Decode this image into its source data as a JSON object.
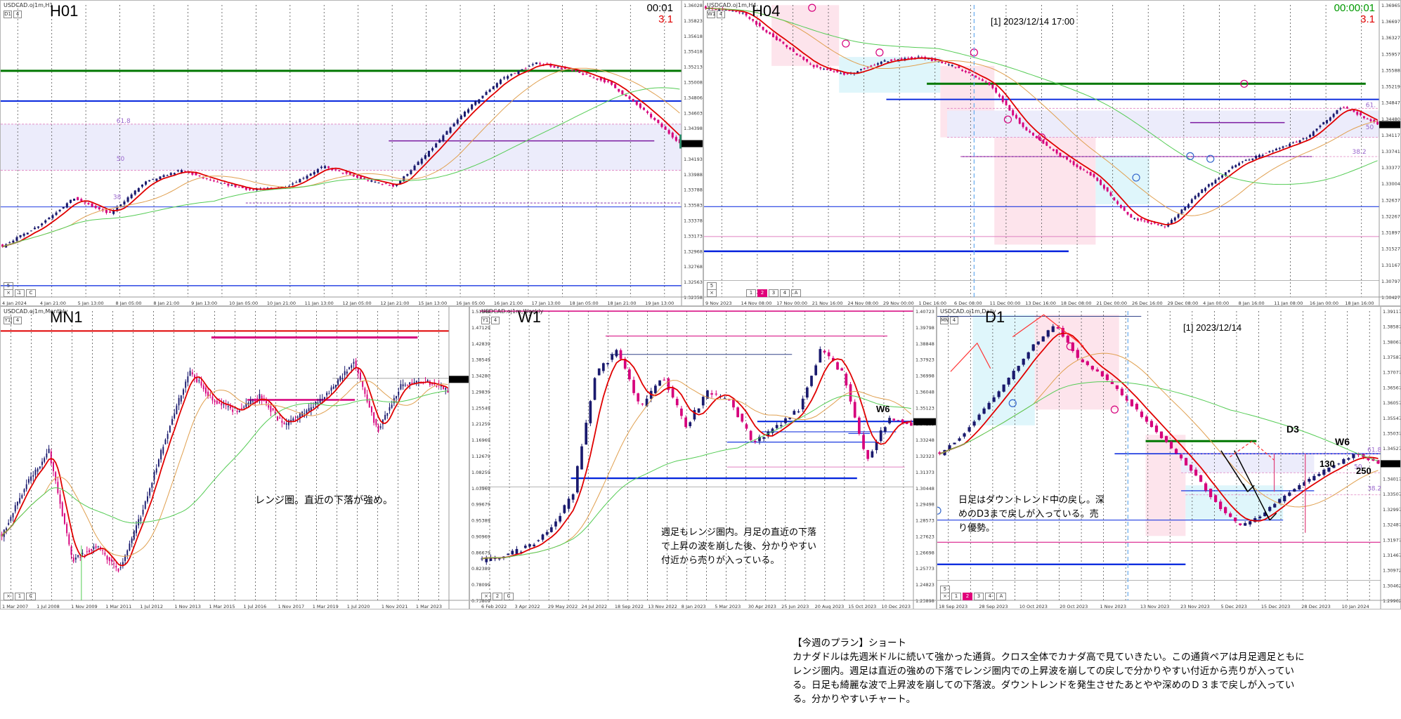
{
  "panels": {
    "h1": {
      "symbol": "USDCAD.oj1m,H1",
      "title": "H01",
      "clock": "00:01",
      "spread": "3.1",
      "tf_buttons": [
        "D1",
        "4"
      ],
      "bottom_buttons": [
        "5",
        "×",
        "1",
        "C"
      ],
      "fib_labels": [
        "61.8",
        "50",
        "38"
      ],
      "y_ticks": [
        "1.36028",
        "1.35823",
        "1.35618",
        "1.35418",
        "1.35213",
        "1.35008",
        "1.34806",
        "1.34603",
        "1.34398",
        "1.34285",
        "1.34193",
        "1.33988",
        "1.33788",
        "1.33583",
        "1.33378",
        "1.33173",
        "1.32968",
        "1.32768",
        "1.32563",
        "1.32358"
      ],
      "x_ticks": [
        "4 Jan 2024",
        "4 Jan 21:00",
        "5 Jan 13:00",
        "8 Jan 05:00",
        "8 Jan 21:00",
        "9 Jan 13:00",
        "10 Jan 05:00",
        "10 Jan 21:00",
        "11 Jan 13:00",
        "12 Jan 05:00",
        "12 Jan 21:00",
        "15 Jan 13:00",
        "16 Jan 05:00",
        "16 Jan 21:00",
        "17 Jan 13:00",
        "18 Jan 05:00",
        "18 Jan 21:00",
        "19 Jan 13:00"
      ]
    },
    "h4": {
      "symbol": "USDCAD.oj1m,H4",
      "title": "H04",
      "clock": "00:00:01",
      "spread": "3.1",
      "tf_buttons": [
        "W1",
        "4"
      ],
      "bottom_buttons": [
        "5",
        "×",
        "1",
        "2",
        "3",
        "4",
        "A"
      ],
      "marker": "[1] 2023/12/14 17:00",
      "fib_labels": [
        "61.",
        "50",
        "38.2"
      ],
      "y_ticks": [
        "1.36965",
        "1.36697",
        "1.36327",
        "1.35957",
        "1.35588",
        "1.35219",
        "1.34847",
        "1.34480",
        "1.34117",
        "1.33741",
        "1.33377",
        "1.33004",
        "1.32637",
        "1.32267",
        "1.31897",
        "1.31527",
        "1.31167",
        "1.30797",
        "1.30427"
      ],
      "x_ticks": [
        "9 Nov 2023",
        "14 Nov 08:00",
        "17 Nov 00:00",
        "21 Nov 16:00",
        "24 Nov 08:00",
        "29 Nov 00:00",
        "1 Dec 16:00",
        "6 Dec 08:00",
        "11 Dec 00:00",
        "13 Dec 16:00",
        "18 Dec 08:00",
        "21 Dec 00:00",
        "26 Dec 16:00",
        "29 Dec 08:00",
        "4 Jan 00:00",
        "8 Jan 16:00",
        "11 Jan 08:00",
        "16 Jan 00:00",
        "18 Jan 16:00"
      ]
    },
    "mn1": {
      "symbol": "USDCAD.oj1m,Monthly",
      "title": "MN1",
      "tf_buttons": [
        "Y1",
        "4"
      ],
      "bottom_buttons": [
        "×",
        "1",
        "C"
      ],
      "note": "レンジ圏。直近の下落が強め。",
      "x_ticks": [
        "1 Mar 2007",
        "1 Jul 2008",
        "1 Nov 2009",
        "1 Mar 2011",
        "1 Jul 2012",
        "1 Nov 2013",
        "1 Mar 2015",
        "1 Jul 2016",
        "1 Nov 2017",
        "1 Mar 2019",
        "1 Jul 2020",
        "1 Nov 2021",
        "1 Mar 2023"
      ]
    },
    "w1": {
      "symbol": "USDCAD.oj1m,Weekly",
      "title": "W1",
      "tf_buttons": [
        "Y1",
        "4"
      ],
      "bottom_buttons": [
        "×",
        "2",
        "C"
      ],
      "label": "W6",
      "note_lines": [
        "週足もレンジ圏内。月足の直近の下落",
        "で上昇の波を崩した後、分かりやすい",
        "付近から売りが入っている。"
      ],
      "y_ticks_left": [
        "1.51549",
        "1.47129",
        "1.42839",
        "1.38549",
        "1.34280",
        "1.29839",
        "1.25549",
        "1.21259",
        "1.16969",
        "1.12679",
        "1.08259",
        "1.03969",
        "0.99679",
        "0.95389",
        "0.90969",
        "0.86679",
        "0.82389",
        "0.78099",
        "0.73809"
      ],
      "y_ticks_right": [
        "1.40723",
        "1.39798",
        "1.38848",
        "1.37923",
        "1.36998",
        "1.36048",
        "1.35123",
        "1.34285",
        "1.33248",
        "1.32323",
        "1.31373",
        "1.30448",
        "1.29498",
        "1.28573",
        "1.27623",
        "1.26698",
        "1.25773",
        "1.24823",
        "1.23898"
      ],
      "x_ticks": [
        "6 Feb 2022",
        "3 Apr 2022",
        "29 May 2022",
        "24 Jul 2022",
        "18 Sep 2022",
        "13 Nov 2022",
        "8 Jan 2023",
        "5 Mar 2023",
        "30 Apr 2023",
        "25 Jun 2023",
        "20 Aug 2023",
        "15 Oct 2023",
        "10 Dec 2023"
      ]
    },
    "d1": {
      "symbol": "USDCAD.oj1m,Daily",
      "title": "D1",
      "tf_buttons": [
        "MN",
        "4"
      ],
      "bottom_buttons": [
        "5",
        "×",
        "1",
        "2",
        "3",
        "4",
        "A"
      ],
      "marker": "[1] 2023/12/14",
      "labels": {
        "d3": "D3",
        "w6": "W6",
        "n130": "130",
        "n250": "250"
      },
      "fib_labels": [
        "61.8",
        "50",
        "38.2"
      ],
      "note_lines": [
        "日足はダウントレンド中の戻し。深",
        "めのD3まで戻しが入っている。売",
        "り優勢。"
      ],
      "y_ticks": [
        "1.39117",
        "1.38587",
        "1.38067",
        "1.37587",
        "1.37077",
        "1.36567",
        "1.36057",
        "1.35547",
        "1.35037",
        "1.34527",
        "1.34285",
        "1.34017",
        "1.33507",
        "1.32997",
        "1.32487",
        "1.31977",
        "1.31467",
        "1.30972",
        "1.30462",
        "1.29962"
      ],
      "x_ticks": [
        "18 Sep 2023",
        "28 Sep 2023",
        "10 Oct 2023",
        "20 Oct 2023",
        "1 Nov 2023",
        "13 Nov 2023",
        "23 Nov 2023",
        "5 Dec 2023",
        "15 Dec 2023",
        "28 Dec 2023",
        "10 Jan 2024"
      ]
    }
  },
  "plan": {
    "heading": "【今週のプラン】ショート",
    "lines": [
      "カナダドルは先週米ドルに続いて強かった通貨。クロス全体でカナダ高で見ていきたい。この通貨ペアは月足週足ともに",
      "レンジ圏内。週足は直近の強めの下落でレンジ圏内での上昇波を崩しての戻しで分かりやすい付近から売りが入ってい",
      "る。日足も綺麗な波で上昇波を崩しての下落波。ダウントレンドを発生させたあとやや深めのＤ３まで戻しが入ってい",
      "る。分かりやすいチャート。"
    ]
  },
  "colors": {
    "bull": "#1a1a6e",
    "bear": "#d6007c",
    "ma_red": "#e00000",
    "ma_orange": "#e0a050",
    "ma_green": "#55cc55",
    "line_blue": "#0022dd",
    "line_green": "#007700",
    "line_purple": "#7a1aa0",
    "zone_lav": "#ececfb",
    "zone_pink": "#fde4ec",
    "zone_cyan": "#dff6fb"
  },
  "chart_data": [
    {
      "type": "candlestick",
      "title": "H01",
      "y_range": [
        1.32358,
        1.36028
      ],
      "approx_close": [
        1.33,
        1.3325,
        1.336,
        1.334,
        1.338,
        1.3395,
        1.338,
        1.337,
        1.3375,
        1.34,
        1.3385,
        1.3375,
        1.342,
        1.347,
        1.351,
        1.353,
        1.352,
        1.3505,
        1.347,
        1.3429
      ]
    },
    {
      "type": "candlestick",
      "title": "H04",
      "y_range": [
        1.30427,
        1.36965
      ],
      "approx_close": [
        1.369,
        1.368,
        1.362,
        1.356,
        1.354,
        1.357,
        1.358,
        1.356,
        1.352,
        1.342,
        1.336,
        1.331,
        1.322,
        1.32,
        1.328,
        1.334,
        1.337,
        1.34,
        1.347,
        1.3429
      ]
    },
    {
      "type": "candlestick",
      "title": "MN1",
      "approx_close": [
        1.05,
        1.15,
        1.22,
        1.0,
        1.03,
        0.98,
        1.1,
        1.25,
        1.38,
        1.32,
        1.3,
        1.33,
        1.27,
        1.3,
        1.34,
        1.4,
        1.26,
        1.35,
        1.36,
        1.34
      ]
    },
    {
      "type": "candlestick",
      "title": "W1",
      "y_range": [
        0.73809,
        1.51549
      ],
      "approx_close": [
        0.84,
        0.86,
        0.92,
        1.0,
        1.12,
        1.33,
        1.36,
        1.32,
        1.35,
        1.34,
        1.33,
        1.36,
        1.32,
        1.33,
        1.35,
        1.38,
        1.36,
        1.32,
        1.35,
        1.34
      ]
    },
    {
      "type": "candlestick",
      "title": "D1",
      "y_range": [
        1.29962,
        1.39117
      ],
      "approx_close": [
        1.346,
        1.352,
        1.361,
        1.37,
        1.38,
        1.387,
        1.376,
        1.371,
        1.364,
        1.356,
        1.348,
        1.34,
        1.33,
        1.323,
        1.327,
        1.333,
        1.338,
        1.342,
        1.346,
        1.3429
      ]
    }
  ]
}
